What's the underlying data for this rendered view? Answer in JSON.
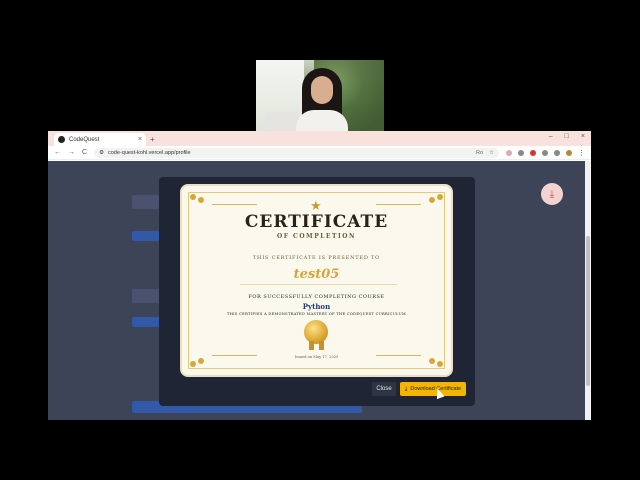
{
  "browser": {
    "tab_title": "CodeQuest",
    "tab_close": "×",
    "new_tab": "+",
    "window_controls": [
      "–",
      "□",
      "×"
    ],
    "nav": {
      "back": "←",
      "forward": "→",
      "reload": "C"
    },
    "url": "code-quest-kohl.vercel.app/profile",
    "omnibox_right": [
      "Ro",
      "☆"
    ]
  },
  "page": {
    "download_fab_icon": "download-icon"
  },
  "modal": {
    "certificate": {
      "title": "CERTIFICATE",
      "subtitle": "OF COMPLETION",
      "presented_text": "THIS CERTIFICATE IS PRESENTED TO",
      "recipient": "test05",
      "completing_text": "FOR SUCCESSFULLY COMPLETING COURSE",
      "course": "Python",
      "description": "THIS CERTIFIES A DEMONSTRATED MASTERY OF THE CODEQUEST CURRICULUM",
      "issued": "Issued on May 17, 2025"
    },
    "close_label": "Close",
    "download_label": "Download Certificate"
  },
  "colors": {
    "modal_bg": "#1f2534",
    "download_button": "#f5b400",
    "gold": "#d2a63c",
    "course_blue": "#1e3a7a"
  }
}
